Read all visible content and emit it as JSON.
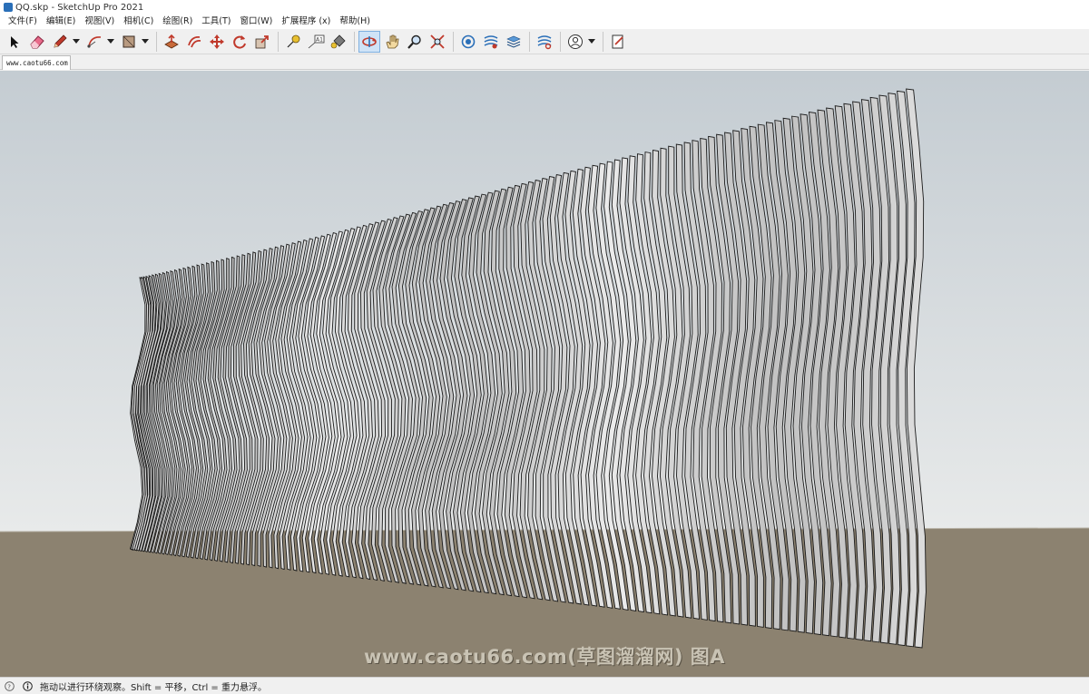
{
  "window": {
    "title": "QQ.skp - SketchUp Pro 2021"
  },
  "menu": [
    "文件(F)",
    "编辑(E)",
    "视图(V)",
    "相机(C)",
    "绘图(R)",
    "工具(T)",
    "窗口(W)",
    "扩展程序 (x)",
    "帮助(H)"
  ],
  "toolbar": {
    "tools": [
      {
        "name": "select-tool",
        "icon": "arrow-icon"
      },
      {
        "name": "eraser-tool",
        "icon": "eraser-icon"
      },
      {
        "name": "line-tool",
        "icon": "pencil-icon",
        "dropdown": true
      },
      {
        "name": "arc-tool",
        "icon": "arc-icon",
        "dropdown": true
      },
      {
        "name": "shape-tool",
        "icon": "rectangle-icon",
        "dropdown": true
      },
      {
        "name": "push-pull-tool",
        "icon": "push-pull-icon"
      },
      {
        "name": "offset-tool",
        "icon": "offset-icon"
      },
      {
        "name": "move-tool",
        "icon": "move-icon"
      },
      {
        "name": "rotate-tool",
        "icon": "rotate-icon"
      },
      {
        "name": "scale-tool",
        "icon": "scale-icon"
      },
      {
        "name": "tape-measure-tool",
        "icon": "tape-icon"
      },
      {
        "name": "text-tool",
        "icon": "text-icon"
      },
      {
        "name": "paint-bucket-tool",
        "icon": "paint-bucket-icon"
      },
      {
        "name": "orbit-tool",
        "icon": "orbit-icon",
        "active": true
      },
      {
        "name": "pan-tool",
        "icon": "hand-icon"
      },
      {
        "name": "zoom-tool",
        "icon": "magnifier-icon"
      },
      {
        "name": "zoom-extents-tool",
        "icon": "zoom-extents-icon"
      },
      {
        "name": "3d-warehouse-button",
        "icon": "warehouse-icon"
      },
      {
        "name": "extension-warehouse-button",
        "icon": "extension-icon"
      },
      {
        "name": "layout-button",
        "icon": "layers-icon"
      },
      {
        "name": "extension-manager-button",
        "icon": "extension-manager-icon"
      },
      {
        "name": "user-account-button",
        "icon": "user-icon",
        "dropdown": true
      },
      {
        "name": "send-to-layout-button",
        "icon": "document-icon"
      }
    ]
  },
  "tabs": [
    {
      "label": "www.caotu66.com"
    }
  ],
  "viewport": {
    "sky_top": "#c4ccd2",
    "sky_bottom": "#e8eaea",
    "ground": "#8c8270",
    "model": "parametric wavy wood fin wall"
  },
  "watermark": "www.caotu66.com(草图溜溜网) 图A",
  "status": {
    "text": "拖动以进行环绕观察。Shift = 平移，Ctrl = 重力悬浮。",
    "icons": [
      "question-icon",
      "info-icon"
    ]
  }
}
